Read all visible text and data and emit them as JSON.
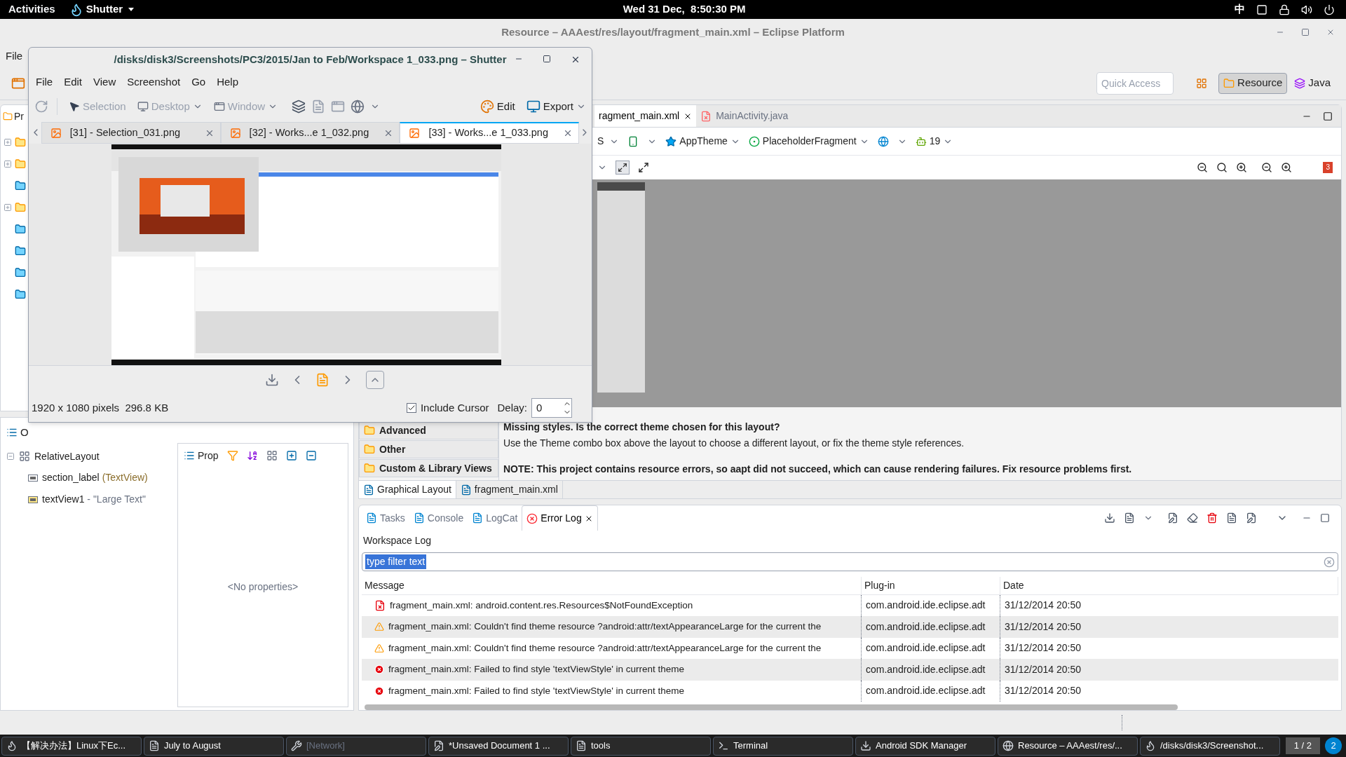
{
  "top_bar": {
    "activities": "Activities",
    "app": "Shutter",
    "clock": "Wed 31 Dec,  8:50:30 PM",
    "input_method": "中"
  },
  "eclipse": {
    "title": "Resource – AAAest/res/layout/fragment_main.xml – Eclipse Platform",
    "menu": [
      "File"
    ],
    "quick_access": {
      "placeholder": "Quick Access"
    },
    "perspectives": [
      {
        "label": "Resource",
        "selected": true
      },
      {
        "label": "Java",
        "selected": false
      }
    ],
    "explorer_tab": "Pr",
    "editor_tabs": [
      {
        "label": "ragment_main.xml",
        "selected": true
      },
      {
        "label": "MainActivity.java",
        "selected": false
      }
    ],
    "config_bar": {
      "device": "S",
      "theme": "AppTheme",
      "fragment": "PlaceholderFragment",
      "api": "19"
    },
    "error_badge": "3",
    "palette": [
      "Advanced",
      "Other",
      "Custom & Library Views"
    ],
    "messages": [
      {
        "text": "Missing styles. Is the correct theme chosen for this layout?",
        "bold": true
      },
      {
        "text": "Use the Theme combo box above the layout to choose a different layout, or fix the theme style references.",
        "bold": false
      },
      {
        "text": "NOTE: This project contains resource errors, so aapt did not succeed, which can cause rendering failures. Fix resource problems first.",
        "bold": true
      }
    ],
    "editor_bottom_tabs": [
      {
        "label": "Graphical Layout",
        "selected": true
      },
      {
        "label": "fragment_main.xml",
        "selected": false
      }
    ],
    "outline_tab": "O",
    "outline": {
      "label": "RelativeLayout",
      "expanded": true,
      "children": [
        {
          "label": "section_label",
          "detail": "(TextView)",
          "warning": false
        },
        {
          "label": "textView1",
          "detail": "- \"Large Text\"",
          "warning": true
        }
      ]
    },
    "properties": {
      "tab": "Prop",
      "empty": "<No properties>"
    },
    "bottom_tabs": [
      {
        "label": "Tasks",
        "selected": false
      },
      {
        "label": "Console",
        "selected": false
      },
      {
        "label": "LogCat",
        "selected": false
      },
      {
        "label": "Error Log",
        "selected": true
      }
    ],
    "log": {
      "title": "Workspace Log",
      "filter": "type filter text",
      "columns": [
        "Message",
        "Plug-in",
        "Date"
      ],
      "rows": [
        {
          "kind": "file-error",
          "message": "fragment_main.xml: android.content.res.Resources$NotFoundException",
          "plugin": "com.android.ide.eclipse.adt",
          "date": "31/12/2014 20:50"
        },
        {
          "kind": "warning",
          "message": "fragment_main.xml: Couldn't find theme resource ?android:attr/textAppearanceLarge for the current the",
          "plugin": "com.android.ide.eclipse.adt",
          "date": "31/12/2014 20:50"
        },
        {
          "kind": "warning",
          "message": "fragment_main.xml: Couldn't find theme resource ?android:attr/textAppearanceLarge for the current the",
          "plugin": "com.android.ide.eclipse.adt",
          "date": "31/12/2014 20:50"
        },
        {
          "kind": "error",
          "message": "fragment_main.xml: Failed to find style 'textViewStyle' in current theme",
          "plugin": "com.android.ide.eclipse.adt",
          "date": "31/12/2014 20:50"
        },
        {
          "kind": "error",
          "message": "fragment_main.xml: Failed to find style 'textViewStyle' in current theme",
          "plugin": "com.android.ide.eclipse.adt",
          "date": "31/12/2014 20:50"
        }
      ]
    }
  },
  "shutter": {
    "title": "/disks/disk3/Screenshots/PC3/2015/Jan to Feb/Workspace 1_033.png – Shutter",
    "menu": [
      "File",
      "Edit",
      "View",
      "Screenshot",
      "Go",
      "Help"
    ],
    "capture_tools": [
      {
        "label": "Selection",
        "disabled": true
      },
      {
        "label": "Desktop",
        "disabled": true
      },
      {
        "label": "Window",
        "disabled": true
      }
    ],
    "edit": "Edit",
    "export": "Export",
    "tabs": [
      {
        "label": "[31] - Selection_031.png",
        "selected": false
      },
      {
        "label": "[32] - Works...e 1_032.png",
        "selected": false
      },
      {
        "label": "[33] - Works...e 1_033.png",
        "selected": true
      }
    ],
    "status": "1920 x 1080 pixels  296.8 KB",
    "include_cursor": {
      "label": "Include Cursor",
      "checked": true
    },
    "delay": {
      "label": "Delay:",
      "value": "0"
    }
  },
  "taskbar": {
    "items": [
      {
        "label": "【解决办法】Linux下Ec...",
        "dimmed": false
      },
      {
        "label": "July to August",
        "dimmed": false
      },
      {
        "label": "[Network]",
        "dimmed": true
      },
      {
        "label": "*Unsaved Document 1 ...",
        "dimmed": false
      },
      {
        "label": "tools",
        "dimmed": false
      },
      {
        "label": "Terminal",
        "dimmed": false
      },
      {
        "label": "Android SDK Manager",
        "dimmed": false
      },
      {
        "label": "Resource – AAAest/res/...",
        "dimmed": false
      },
      {
        "label": "/disks/disk3/Screenshot...",
        "dimmed": false
      }
    ],
    "pager": "1 / 2",
    "notifications": "2"
  }
}
